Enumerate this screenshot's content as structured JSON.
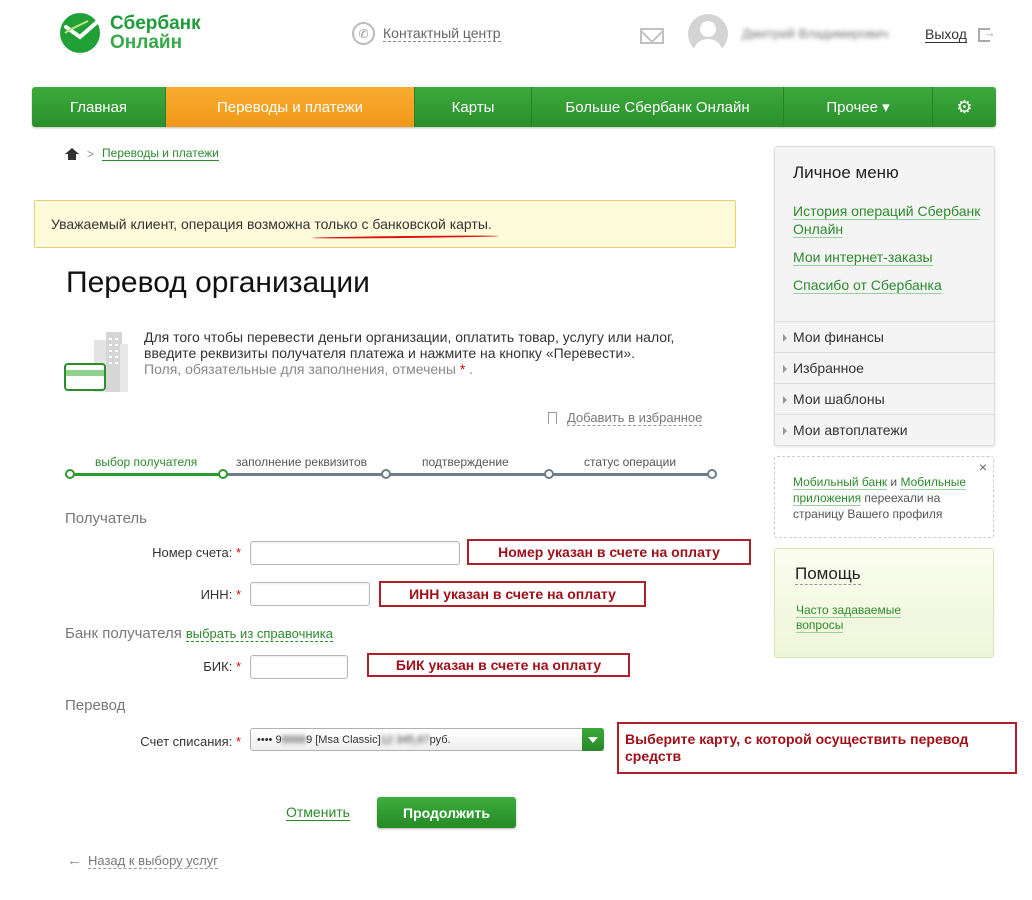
{
  "header": {
    "logo_line1": "Сбербанк",
    "logo_line2": "Онлайн",
    "contact_center": "Контактный центр",
    "username": "Дмитрий Владимирович",
    "logout": "Выход"
  },
  "nav": {
    "items": [
      {
        "label": "Главная"
      },
      {
        "label": "Переводы и платежи"
      },
      {
        "label": "Карты"
      },
      {
        "label": "Больше Сбербанк Онлайн"
      },
      {
        "label": "Прочее ▾"
      },
      {
        "label": "⚙"
      }
    ],
    "active_index": 1
  },
  "breadcrumb": {
    "separator": ">",
    "current": "Переводы и платежи"
  },
  "alert": {
    "prefix": "Уважаемый клиент, операция возможна ",
    "highlight": "только с банковской карты."
  },
  "page_title": "Перевод организации",
  "info": {
    "text": "Для того чтобы перевести деньги организации, оплатить товар, услугу или налог, введите реквизиты получателя платежа и нажмите на кнопку «Перевести».",
    "note": "Поля, обязательные для заполнения, отмечены",
    "note_mark": "*",
    "note_end": " ."
  },
  "favorites_link": "Добавить в избранное",
  "steps": [
    {
      "label": "выбор получателя",
      "active": true
    },
    {
      "label": "заполнение реквизитов",
      "active": false
    },
    {
      "label": "подтверждение",
      "active": false
    },
    {
      "label": "статус операции",
      "active": false
    }
  ],
  "form": {
    "recipient_section": "Получатель",
    "account_label": "Номер счета:",
    "account_value": "",
    "inn_label": "ИНН:",
    "inn_value": "",
    "bank_section": "Банк получателя",
    "bank_ref_link": "выбрать из справочника",
    "bik_label": "БИК:",
    "bik_value": "",
    "transfer_section": "Перевод",
    "debit_label": "Счет списания:",
    "debit_select": {
      "prefix": "•••• 9",
      "masked1": "8888",
      "mid": "9 [Msa Classic] ",
      "masked2": "12 345,67",
      "currency": " руб."
    },
    "required_mark": "*",
    "cancel": "Отменить",
    "continue": "Продолжить"
  },
  "callouts": {
    "account": "Номер указан в счете на оплату",
    "inn": "ИНН указан в счете на оплату",
    "bik": "БИК указан в счете на оплату",
    "debit": "Выберите карту, с которой осуществить перевод средств"
  },
  "back_link": "Назад к выбору услуг",
  "sidebar": {
    "personal_menu_title": "Личное меню",
    "links": [
      "История операций Сбербанк Онлайн",
      "Мои интернет-заказы",
      "Спасибо от Сбербанка"
    ],
    "rows": [
      "Мои финансы",
      "Избранное",
      "Мои шаблоны",
      "Мои автоплатежи"
    ],
    "notice": {
      "link1": "Мобильный банк",
      "and": " и ",
      "link2": "Мобильные приложения",
      "rest": " переехали на страницу Вашего профиля",
      "close": "×"
    },
    "help": {
      "title": "Помощь",
      "link": "Часто задаваемые вопросы"
    }
  },
  "colors": {
    "brand_green": "#2e9a2e",
    "nav_active_orange": "#f0981a",
    "callout_red": "#b0202a",
    "alert_bg": "#fdfbd9"
  }
}
